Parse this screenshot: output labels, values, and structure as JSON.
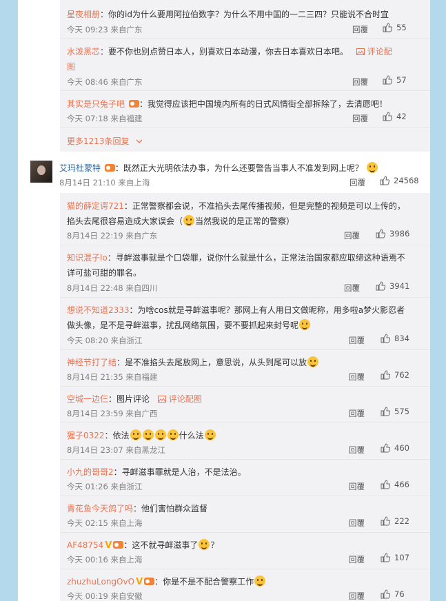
{
  "top_replies": [
    {
      "name": "星夜相册",
      "sep": "：",
      "text": "你的id为什么要用阿拉伯数字？为什么不用中国的一二三四？只能说不合时宜",
      "time": "今天 09:23 来自广东",
      "reply": "回覆",
      "likes": "55"
    },
    {
      "name": "水泼黑芯",
      "text_a": "：要不你也别点赞日本人，别喜欢日本动漫，你去日本喜欢日本吧。",
      "pic_label": "评论配",
      "text_b": "图",
      "time": "今天 08:46 来自广东",
      "reply": "回覆",
      "likes": "57"
    },
    {
      "name": "其实是只兔子吧",
      "text": "：我觉得应该把中国境内所有的日式风情街全部拆除了，去清愿吧！",
      "time": "今天 07:18 来自福建",
      "reply": "回覆",
      "likes": "42"
    }
  ],
  "more_replies": "更多1213条回复",
  "main_comment": {
    "name": "艾玛杜蒙特",
    "text": "：既然正大光明依法办事，为什么还要警告当事人不准发到网上呢？",
    "time": "8月14日 21:10 来自上海",
    "reply": "回覆",
    "likes": "24568"
  },
  "replies": [
    {
      "name": "猫的薛定谔721",
      "line1": "：正常警察都会说，不准掐头去尾传播视频，但是完整的视频是可以上传的，",
      "line2a": "掐头去尾很容易造成大家误会（",
      "line2b": "当然我说的是正常的警察）",
      "time": "8月14日 22:19 来自广东",
      "reply": "回覆",
      "likes": "3986"
    },
    {
      "name": "知识混子lo",
      "line1": "：寻衅滋事就是个口袋罪，说你什么就是什么，正常法治国家都应取缔这种语焉不",
      "line2": "详可盐可甜的罪名。",
      "time": "8月14日 22:48 来自四川",
      "reply": "回覆",
      "likes": "3941"
    },
    {
      "name": "想说不知道2333",
      "line1": "：为啥cos就是寻衅滋事呢？那网上有人用日文做昵称，用多啦a梦火影忍者",
      "line2": "做头像，是不是寻衅滋事，扰乱网络氛围，要不要抓起来封号呢",
      "time": "今天 08:20 来自浙江",
      "reply": "回覆",
      "likes": "834"
    },
    {
      "name": "神经节打了结",
      "text": "：是不准掐头去尾放网上，意思说，从头到尾可以放",
      "time": "8月14日 21:35 来自福建",
      "reply": "回覆",
      "likes": "762"
    },
    {
      "name": "空城一边仨",
      "text": "：图片评论",
      "pic_label": "评论配图",
      "time": "8月14日 23:59 来自广西",
      "reply": "回覆",
      "likes": "575"
    },
    {
      "name": "猩子0322",
      "text_a": "：依法",
      "text_b": "什么法",
      "time": "8月14日 23:07 来自黑龙江",
      "reply": "回覆",
      "likes": "460"
    },
    {
      "name": "小九的哥哥2",
      "text": "：寻衅滋事罪就是人治，不是法治。",
      "time": "今天 01:26 来自浙江",
      "reply": "回覆",
      "likes": "466"
    },
    {
      "name": "青花鱼今天鸽了吗",
      "text": "：他们害怕群众监督",
      "time": "今天 02:15 来自上海",
      "reply": "回覆",
      "likes": "222"
    },
    {
      "name": "AF48754",
      "text_a": "：这不就寻衅滋事了",
      "text_b": "？",
      "time": "今天 00:16 来自上海",
      "reply": "回覆",
      "likes": "107"
    },
    {
      "name": "zhuzhuLongOvO",
      "text": "：你是不是不配合警察工作",
      "time": "今天 00:19 来自安徽",
      "reply": "回覆",
      "likes": "76"
    }
  ],
  "colors": {
    "name": "#eb7350",
    "accent": "#eb7350",
    "background": "#b5d9ec",
    "reply_bg": "#f2f2f5"
  }
}
